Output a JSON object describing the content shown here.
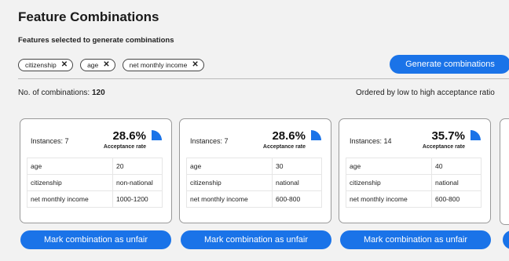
{
  "header": {
    "title": "Feature Combinations",
    "subtitle": "Features selected to generate combinations"
  },
  "features": [
    {
      "label": "citizenship"
    },
    {
      "label": "age"
    },
    {
      "label": "net monthly income"
    }
  ],
  "generate_label": "Generate combinations",
  "summary": {
    "count_label": "No. of combinations:",
    "count_value": "120",
    "order_label": "Ordered by low to high acceptance ratio"
  },
  "colors": {
    "accent": "#1a73e8"
  },
  "cards": [
    {
      "instances": "Instances: 7",
      "rate": "28.6%",
      "rate_fraction": 0.286,
      "rate_label": "Acceptance rate",
      "rows": [
        {
          "key": "age",
          "value": "20"
        },
        {
          "key": "citizenship",
          "value": "non-national"
        },
        {
          "key": "net monthly income",
          "value": "1000-1200"
        }
      ],
      "button": "Mark combination as unfair"
    },
    {
      "instances": "Instances: 7",
      "rate": "28.6%",
      "rate_fraction": 0.286,
      "rate_label": "Acceptance rate",
      "rows": [
        {
          "key": "age",
          "value": "30"
        },
        {
          "key": "citizenship",
          "value": "national"
        },
        {
          "key": "net monthly income",
          "value": "600-800"
        }
      ],
      "button": "Mark combination as unfair"
    },
    {
      "instances": "Instances: 14",
      "rate": "35.7%",
      "rate_fraction": 0.357,
      "rate_label": "Acceptance rate",
      "rows": [
        {
          "key": "age",
          "value": "40"
        },
        {
          "key": "citizenship",
          "value": "national"
        },
        {
          "key": "net monthly income",
          "value": "600-800"
        }
      ],
      "button": "Mark combination as unfair"
    }
  ]
}
